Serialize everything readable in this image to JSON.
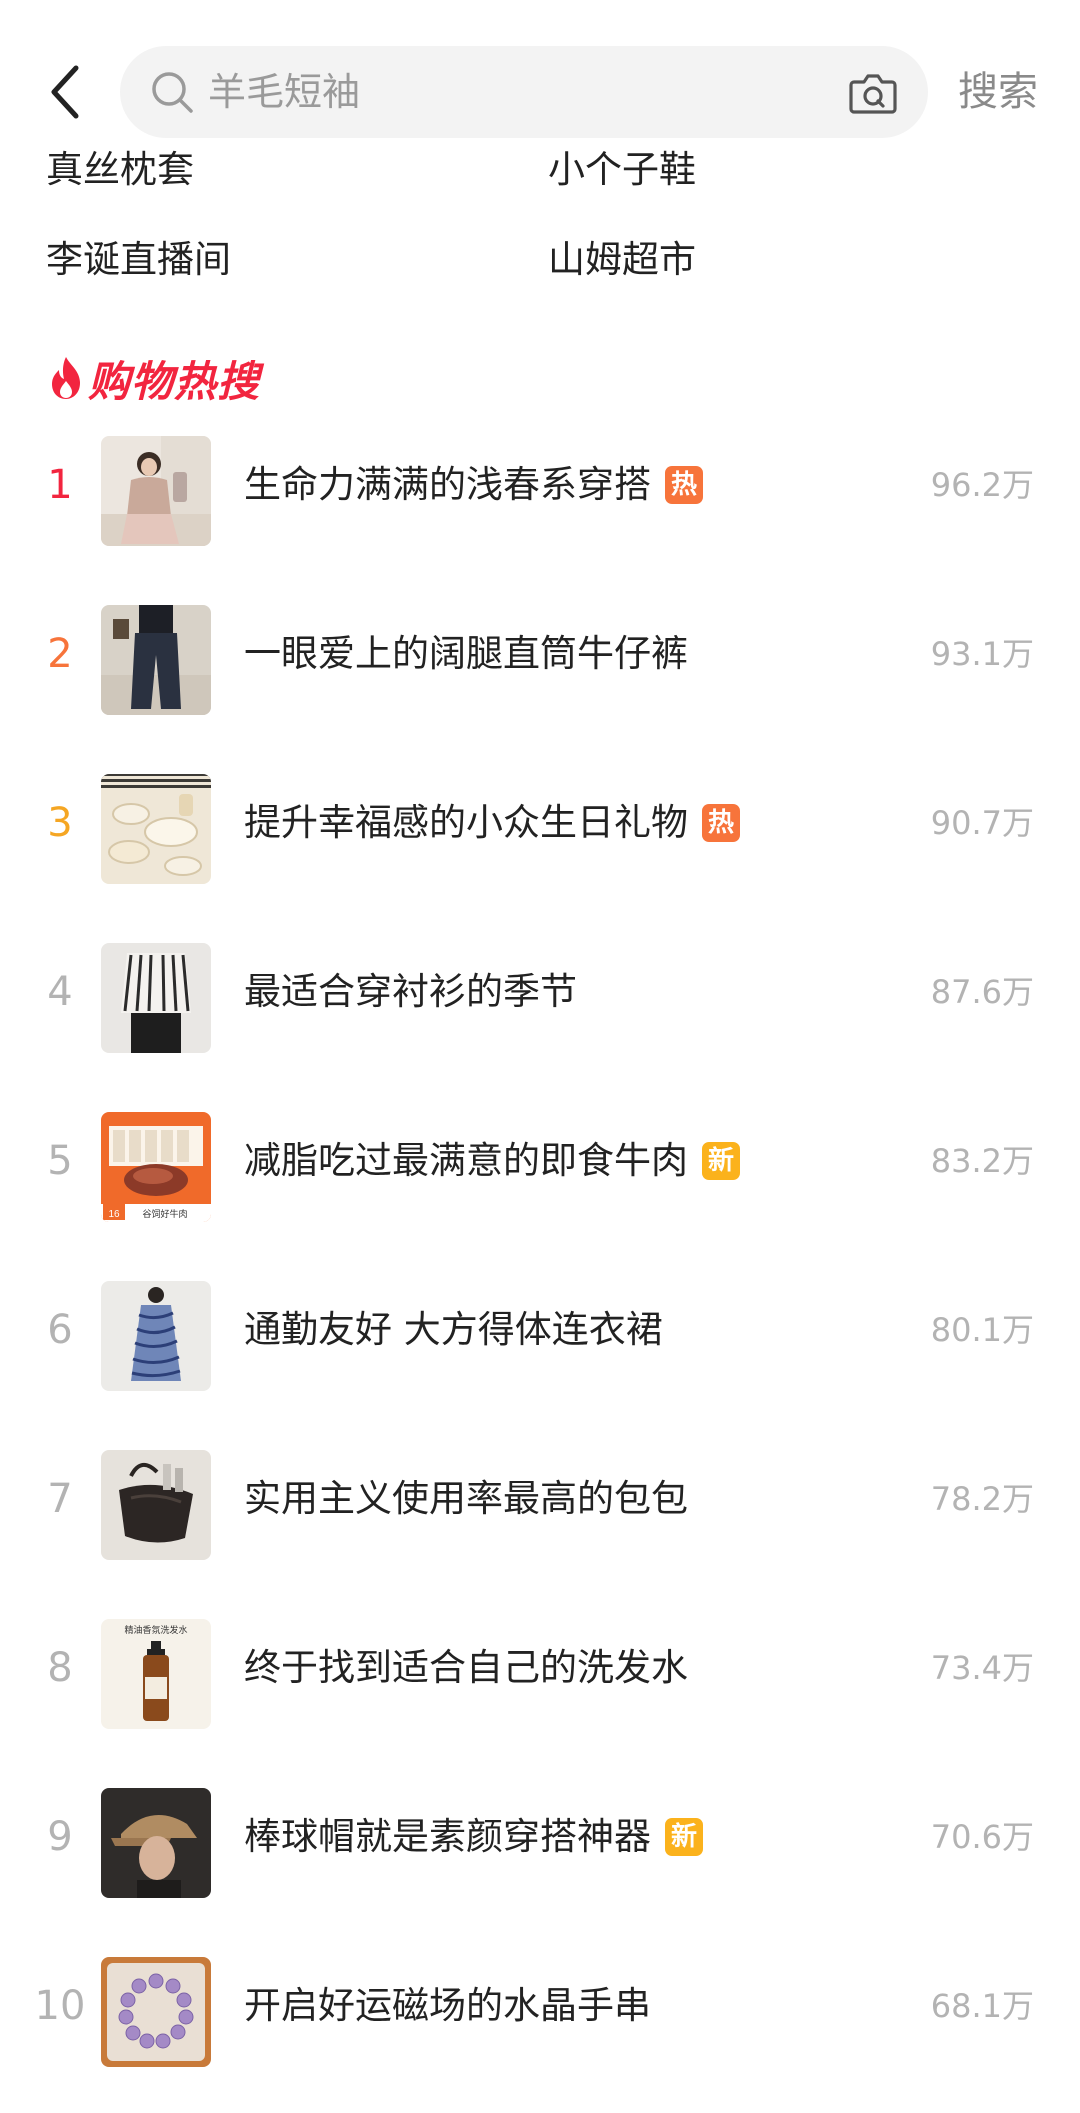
{
  "header": {
    "search_placeholder": "羊毛短袖",
    "search_button": "搜索"
  },
  "suggestions": [
    "真丝枕套",
    "小个子鞋",
    "李诞直播间",
    "山姆超市"
  ],
  "hot_section": {
    "title": "购物热搜"
  },
  "hot_list": [
    {
      "rank": "1",
      "title": "生命力满满的浅春系穿搭",
      "badge": "热",
      "badge_type": "hot",
      "heat": "96.2万",
      "rank_color": "#f2253f",
      "thumb_icon": "fashion-photo"
    },
    {
      "rank": "2",
      "title": "一眼爱上的阔腿直筒牛仔裤",
      "badge": "",
      "badge_type": "",
      "heat": "93.1万",
      "rank_color": "#f7743b",
      "thumb_icon": "jeans-photo"
    },
    {
      "rank": "3",
      "title": "提升幸福感的小众生日礼物",
      "badge": "热",
      "badge_type": "hot",
      "heat": "90.7万",
      "rank_color": "#f5a623",
      "thumb_icon": "tableware-photo"
    },
    {
      "rank": "4",
      "title": "最适合穿衬衫的季节",
      "badge": "",
      "badge_type": "",
      "heat": "87.6万",
      "rank_color": "#b3b3b3",
      "thumb_icon": "shirt-photo"
    },
    {
      "rank": "5",
      "title": "减脂吃过最满意的即食牛肉",
      "badge": "新",
      "badge_type": "new",
      "heat": "83.2万",
      "rank_color": "#b3b3b3",
      "thumb_icon": "beef-photo"
    },
    {
      "rank": "6",
      "title": "通勤友好 大方得体连衣裙",
      "badge": "",
      "badge_type": "",
      "heat": "80.1万",
      "rank_color": "#b3b3b3",
      "thumb_icon": "dress-photo"
    },
    {
      "rank": "7",
      "title": "实用主义使用率最高的包包",
      "badge": "",
      "badge_type": "",
      "heat": "78.2万",
      "rank_color": "#b3b3b3",
      "thumb_icon": "bag-photo"
    },
    {
      "rank": "8",
      "title": "终于找到适合自己的洗发水",
      "badge": "",
      "badge_type": "",
      "heat": "73.4万",
      "rank_color": "#b3b3b3",
      "thumb_icon": "shampoo-photo"
    },
    {
      "rank": "9",
      "title": "棒球帽就是素颜穿搭神器",
      "badge": "新",
      "badge_type": "new",
      "heat": "70.6万",
      "rank_color": "#b3b3b3",
      "thumb_icon": "cap-photo"
    },
    {
      "rank": "10",
      "title": "开启好运磁场的水晶手串",
      "badge": "",
      "badge_type": "",
      "heat": "68.1万",
      "rank_color": "#b3b3b3",
      "thumb_icon": "bracelet-photo"
    }
  ],
  "thumb_texts": {
    "beef_label": "16",
    "beef_caption": "谷饲好牛肉",
    "shampoo_label": "精油香氛洗发水"
  }
}
